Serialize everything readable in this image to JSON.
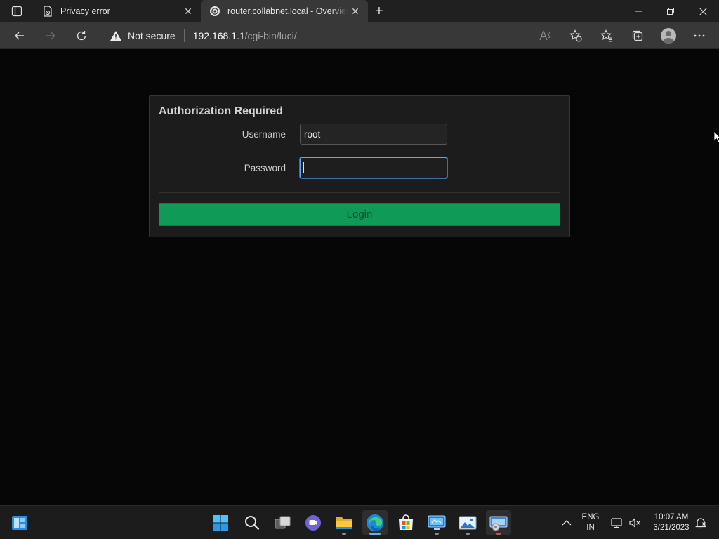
{
  "browser": {
    "tabs": [
      {
        "title": "Privacy error",
        "icon": "privacy-error-icon",
        "active": false
      },
      {
        "title": "router.collabnet.local - Overview",
        "icon": "router-favicon",
        "active": true
      }
    ],
    "security_label": "Not secure",
    "url_host": "192.168.1.1",
    "url_path": "/cgi-bin/luci/"
  },
  "login": {
    "title": "Authorization Required",
    "username_label": "Username",
    "username_value": "root",
    "password_label": "Password",
    "password_value": "",
    "button_label": "Login",
    "button_color": "#109a57"
  },
  "taskbar": {
    "language": "ENG",
    "region": "IN",
    "time": "10:07 AM",
    "date": "3/21/2023",
    "apps": [
      "widgets-icon",
      "start-icon",
      "search-icon",
      "task-view-icon",
      "teams-chat-icon",
      "file-explorer-icon",
      "edge-icon",
      "store-icon",
      "remote-desktop-icon",
      "photos-icon",
      "network-tool-icon"
    ]
  },
  "colors": {
    "accent": "#5aa7ff",
    "page_background": "#060606"
  }
}
